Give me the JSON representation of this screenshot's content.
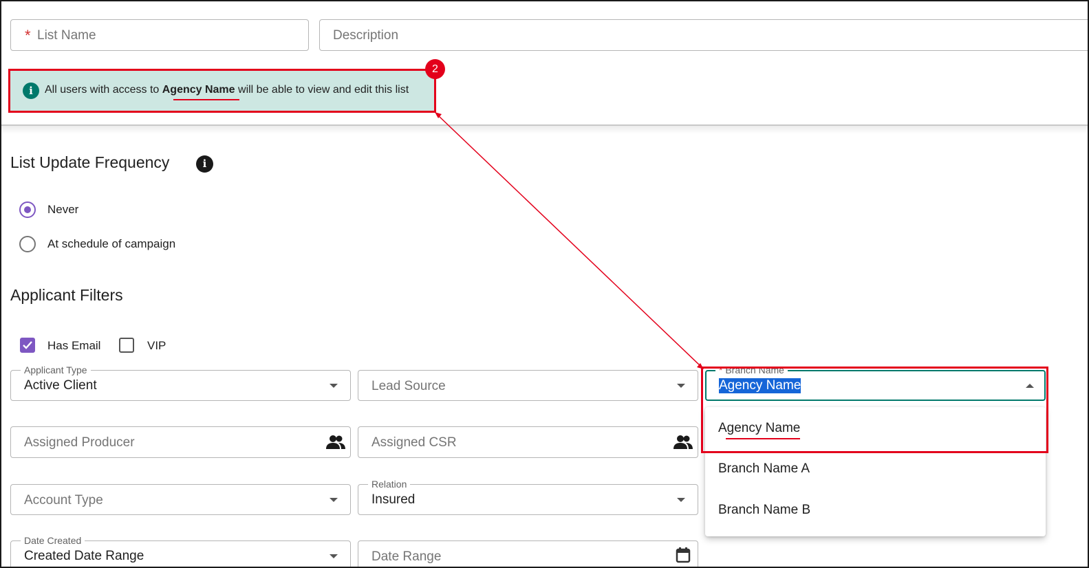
{
  "top_form": {
    "list_name_required_marker": "*",
    "list_name_placeholder": "List Name",
    "description_placeholder": "Description"
  },
  "notice": {
    "text_before": "All users with access to ",
    "agency_name": "Agency Name",
    "text_after": " will be able to view and edit this list",
    "callout_number": "2"
  },
  "frequency": {
    "title": "List Update Frequency",
    "options": [
      {
        "label": "Never",
        "selected": true
      },
      {
        "label": "At schedule of campaign",
        "selected": false
      }
    ]
  },
  "applicant_filters": {
    "title": "Applicant Filters",
    "has_email_label": "Has Email",
    "has_email_checked": true,
    "vip_label": "VIP",
    "vip_checked": false,
    "applicant_type_label": "Applicant Type",
    "applicant_type_value": "Active Client",
    "lead_source_placeholder": "Lead Source",
    "branch_name_required_marker": "*",
    "branch_name_label": "Branch Name",
    "branch_name_value": "Agency Name",
    "assigned_producer_placeholder": "Assigned Producer",
    "assigned_csr_placeholder": "Assigned CSR",
    "account_type_placeholder": "Account Type",
    "relation_label": "Relation",
    "relation_value": "Insured",
    "date_created_label": "Date Created",
    "date_created_value": "Created Date Range",
    "date_range_placeholder": "Date Range"
  },
  "branch_dropdown": {
    "options": [
      "Agency Name",
      "Branch Name A",
      "Branch Name B"
    ]
  },
  "colors": {
    "accent": "#7e57c2",
    "notice_bg": "#cde7e2",
    "notice_icon": "#00796b",
    "annotation_red": "#e3001b",
    "selection_blue": "#1565d8"
  }
}
